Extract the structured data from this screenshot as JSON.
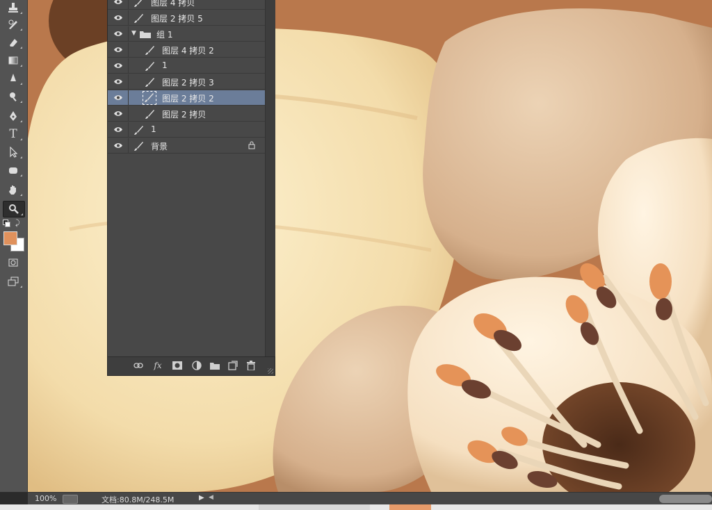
{
  "layers": [
    {
      "name": "图层 4 拷贝",
      "indent": 0,
      "selected": false,
      "thumb": "brush",
      "partial": true
    },
    {
      "name": "图层 2 拷贝 5",
      "indent": 0,
      "selected": false,
      "thumb": "brush"
    },
    {
      "name": "组 1",
      "indent": 0,
      "selected": false,
      "thumb": "folder",
      "group": true
    },
    {
      "name": "图层 4 拷贝 2",
      "indent": 1,
      "selected": false,
      "thumb": "brush"
    },
    {
      "name": "1",
      "indent": 1,
      "selected": false,
      "thumb": "brush"
    },
    {
      "name": "图层 2 拷贝 3",
      "indent": 1,
      "selected": false,
      "thumb": "brush"
    },
    {
      "name": "图层 2 拷贝 2",
      "indent": 1,
      "selected": true,
      "thumb": "brush-selected"
    },
    {
      "name": "图层 2 拷贝",
      "indent": 1,
      "selected": false,
      "thumb": "brush"
    },
    {
      "name": "1",
      "indent": 0,
      "selected": false,
      "thumb": "brush"
    },
    {
      "name": "背景",
      "indent": 0,
      "selected": false,
      "thumb": "brush",
      "locked": true
    }
  ],
  "tools": [
    "stamp-tool-icon",
    "history-brush-icon",
    "eraser-icon",
    "gradient-icon",
    "blur-icon",
    "dodge-icon",
    "pen-icon",
    "type-icon",
    "path-select-icon",
    "rectangle-shape-icon",
    "hand-icon",
    "zoom-icon"
  ],
  "colors": {
    "foreground": "#e0915c",
    "background": "#ffffff",
    "selection": "#6b7d99"
  },
  "footer_icons": [
    "link-icon",
    "fx-icon",
    "mask-icon",
    "adjustment-icon",
    "folder-icon",
    "new-layer-icon",
    "trash-icon"
  ],
  "footer_labels": {
    "fx": "fx"
  },
  "status": {
    "zoom": "100%",
    "doc_info": "文档:80.8M/248.5M"
  }
}
